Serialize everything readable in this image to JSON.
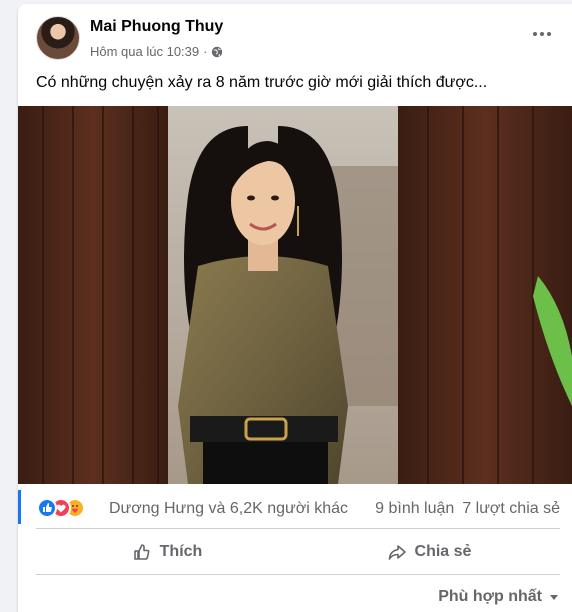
{
  "post": {
    "author": "Mai Phuong Thuy",
    "timestamp": "Hôm qua lúc 10:39",
    "separator": "·",
    "privacy_icon": "globe-icon",
    "more_icon": "more-horizontal-icon",
    "caption": "Có những chuyện xảy ra 8 năm trước giờ mới giải thích được..."
  },
  "reactions": {
    "icons": [
      "like-reaction-icon",
      "love-reaction-icon",
      "care-reaction-icon"
    ],
    "summary": "Dương Hưng và 6,2K người khác",
    "comments": "9 bình luận",
    "shares": "7 lượt chia sẻ"
  },
  "actions": {
    "like_label": "Thích",
    "share_label": "Chia sẻ"
  },
  "comments": {
    "sort_label": "Phù hợp nhất"
  },
  "colors": {
    "brand_blue": "#1877f2",
    "love_red": "#f33e58",
    "care_yellow": "#f7b125",
    "secondary_text": "#65676b"
  }
}
